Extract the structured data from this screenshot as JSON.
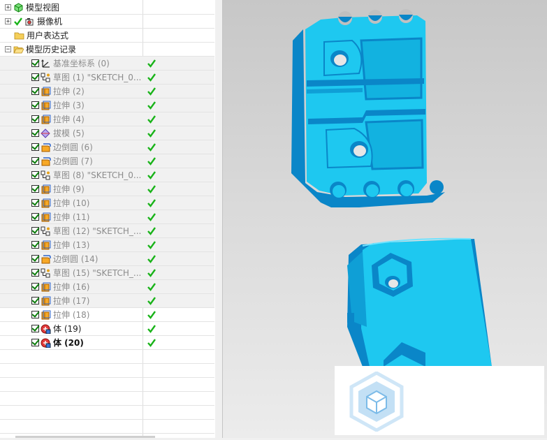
{
  "navigator": {
    "top_items": [
      {
        "label": "模型视图"
      },
      {
        "label": "摄像机"
      },
      {
        "label": "用户表达式"
      },
      {
        "label": "模型历史记录"
      }
    ],
    "features": [
      {
        "label": "基准坐标系 (0)",
        "icon": "datum-csys-icon"
      },
      {
        "label": "草图 (1) \"SKETCH_0...",
        "icon": "sketch-icon"
      },
      {
        "label": "拉伸 (2)",
        "icon": "extrude-icon"
      },
      {
        "label": "拉伸 (3)",
        "icon": "extrude-icon"
      },
      {
        "label": "拉伸 (4)",
        "icon": "extrude-icon"
      },
      {
        "label": "拔模 (5)",
        "icon": "draft-icon"
      },
      {
        "label": "边倒圆 (6)",
        "icon": "edge-blend-icon"
      },
      {
        "label": "边倒圆 (7)",
        "icon": "edge-blend-icon"
      },
      {
        "label": "草图 (8) \"SKETCH_0...",
        "icon": "sketch-icon"
      },
      {
        "label": "拉伸 (9)",
        "icon": "extrude-icon"
      },
      {
        "label": "拉伸 (10)",
        "icon": "extrude-icon"
      },
      {
        "label": "拉伸 (11)",
        "icon": "extrude-icon"
      },
      {
        "label": "草图 (12) \"SKETCH_...",
        "icon": "sketch-icon"
      },
      {
        "label": "拉伸 (13)",
        "icon": "extrude-icon"
      },
      {
        "label": "边倒圆 (14)",
        "icon": "edge-blend-icon"
      },
      {
        "label": "草图 (15) \"SKETCH_...",
        "icon": "sketch-icon"
      },
      {
        "label": "拉伸 (16)",
        "icon": "extrude-icon"
      },
      {
        "label": "拉伸 (17)",
        "icon": "extrude-icon"
      },
      {
        "label": "拉伸 (18)",
        "icon": "extrude-icon"
      },
      {
        "label": "体 (19)",
        "icon": "body-icon"
      },
      {
        "label": "体 (20)",
        "icon": "body-icon"
      }
    ]
  },
  "viewport": {
    "part_color": "#1ec8f0",
    "background_top": "#c7c7c7",
    "background_bottom": "#ececec"
  }
}
